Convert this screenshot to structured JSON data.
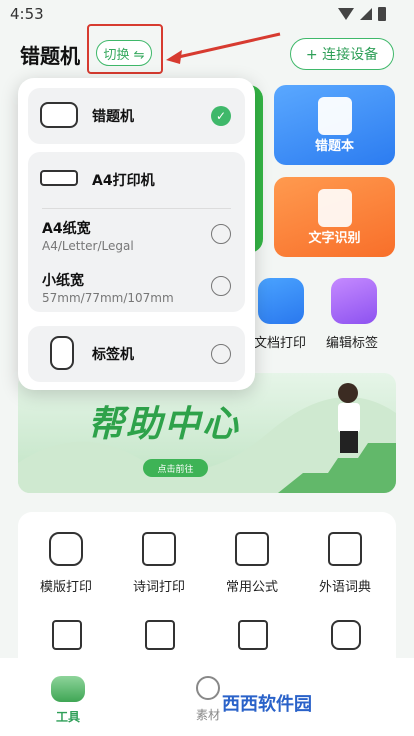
{
  "status": {
    "time": "4:53"
  },
  "header": {
    "title": "错题机",
    "switch_label": "切换 ⇋",
    "connect_label": "+ 连接设备"
  },
  "cards": {
    "mistake_book": "错题本",
    "text_recognition": "文字识别"
  },
  "shortcuts": [
    {
      "label": "文档打印"
    },
    {
      "label": "编辑标签"
    }
  ],
  "banner": {
    "title": "帮助中心",
    "button": "点击前往"
  },
  "tools": [
    {
      "label": "模版打印"
    },
    {
      "label": "诗词打印"
    },
    {
      "label": "常用公式"
    },
    {
      "label": "外语词典"
    }
  ],
  "tabbar": {
    "tab1": "工具",
    "tab2": "素材"
  },
  "popup": {
    "device1": {
      "name": "错题机",
      "selected": true
    },
    "device2": {
      "name": "A4打印机"
    },
    "a4_width": {
      "title": "A4纸宽",
      "desc": "A4/Letter/Legal"
    },
    "small_width": {
      "title": "小纸宽",
      "desc": "57mm/77mm/107mm"
    },
    "device3": {
      "name": "标签机"
    }
  },
  "watermark": "西西软件园"
}
